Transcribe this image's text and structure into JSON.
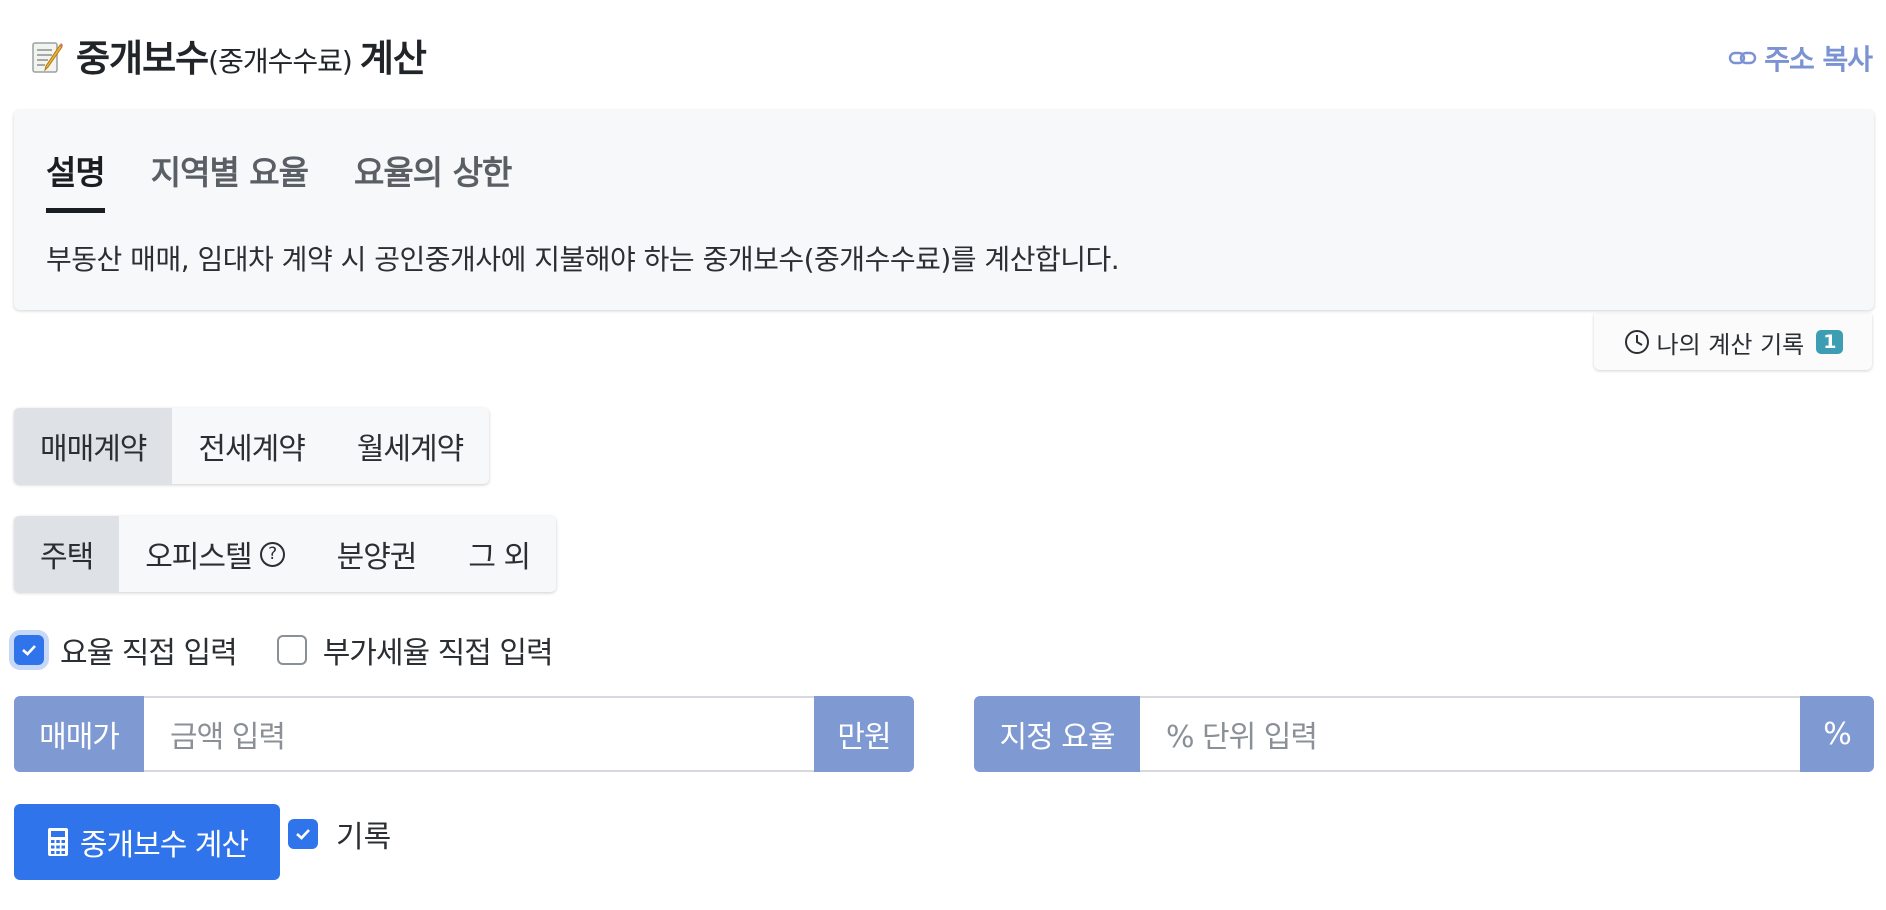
{
  "header": {
    "icon": "memo-icon",
    "title_main": "중개보수",
    "title_sub": "(중개수수료)",
    "title_end": "계산",
    "copy_link": "주소 복사"
  },
  "card": {
    "tabs": [
      {
        "label": "설명",
        "active": true
      },
      {
        "label": "지역별 요율",
        "active": false
      },
      {
        "label": "요율의 상한",
        "active": false
      }
    ],
    "description": "부동산 매매, 임대차 계약 시 공인중개사에 지불해야 하는 중개보수(중개수수료)를 계산합니다."
  },
  "history": {
    "label": "나의 계산 기록",
    "count": "1"
  },
  "contract_types": [
    {
      "label": "매매계약",
      "selected": true
    },
    {
      "label": "전세계약",
      "selected": false
    },
    {
      "label": "월세계약",
      "selected": false
    }
  ],
  "property_types": [
    {
      "label": "주택",
      "selected": true
    },
    {
      "label": "오피스텔",
      "selected": false,
      "help": "?"
    },
    {
      "label": "분양권",
      "selected": false
    },
    {
      "label": "그 외",
      "selected": false
    }
  ],
  "options": {
    "direct_rate": {
      "label": "요율 직접 입력",
      "checked": true
    },
    "direct_vat": {
      "label": "부가세율 직접 입력",
      "checked": false
    }
  },
  "price_input": {
    "prefix": "매매가",
    "placeholder": "금액 입력",
    "suffix": "만원"
  },
  "rate_input": {
    "prefix": "지정 요율",
    "placeholder": "% 단위 입력",
    "suffix": "%"
  },
  "calculate": {
    "label": "중개보수 계산",
    "record_label": "기록",
    "record_checked": true
  },
  "colors": {
    "primary": "#2f74ea",
    "addon": "#7f99d2",
    "badge": "#3d9db3",
    "link": "#7b93d3"
  }
}
